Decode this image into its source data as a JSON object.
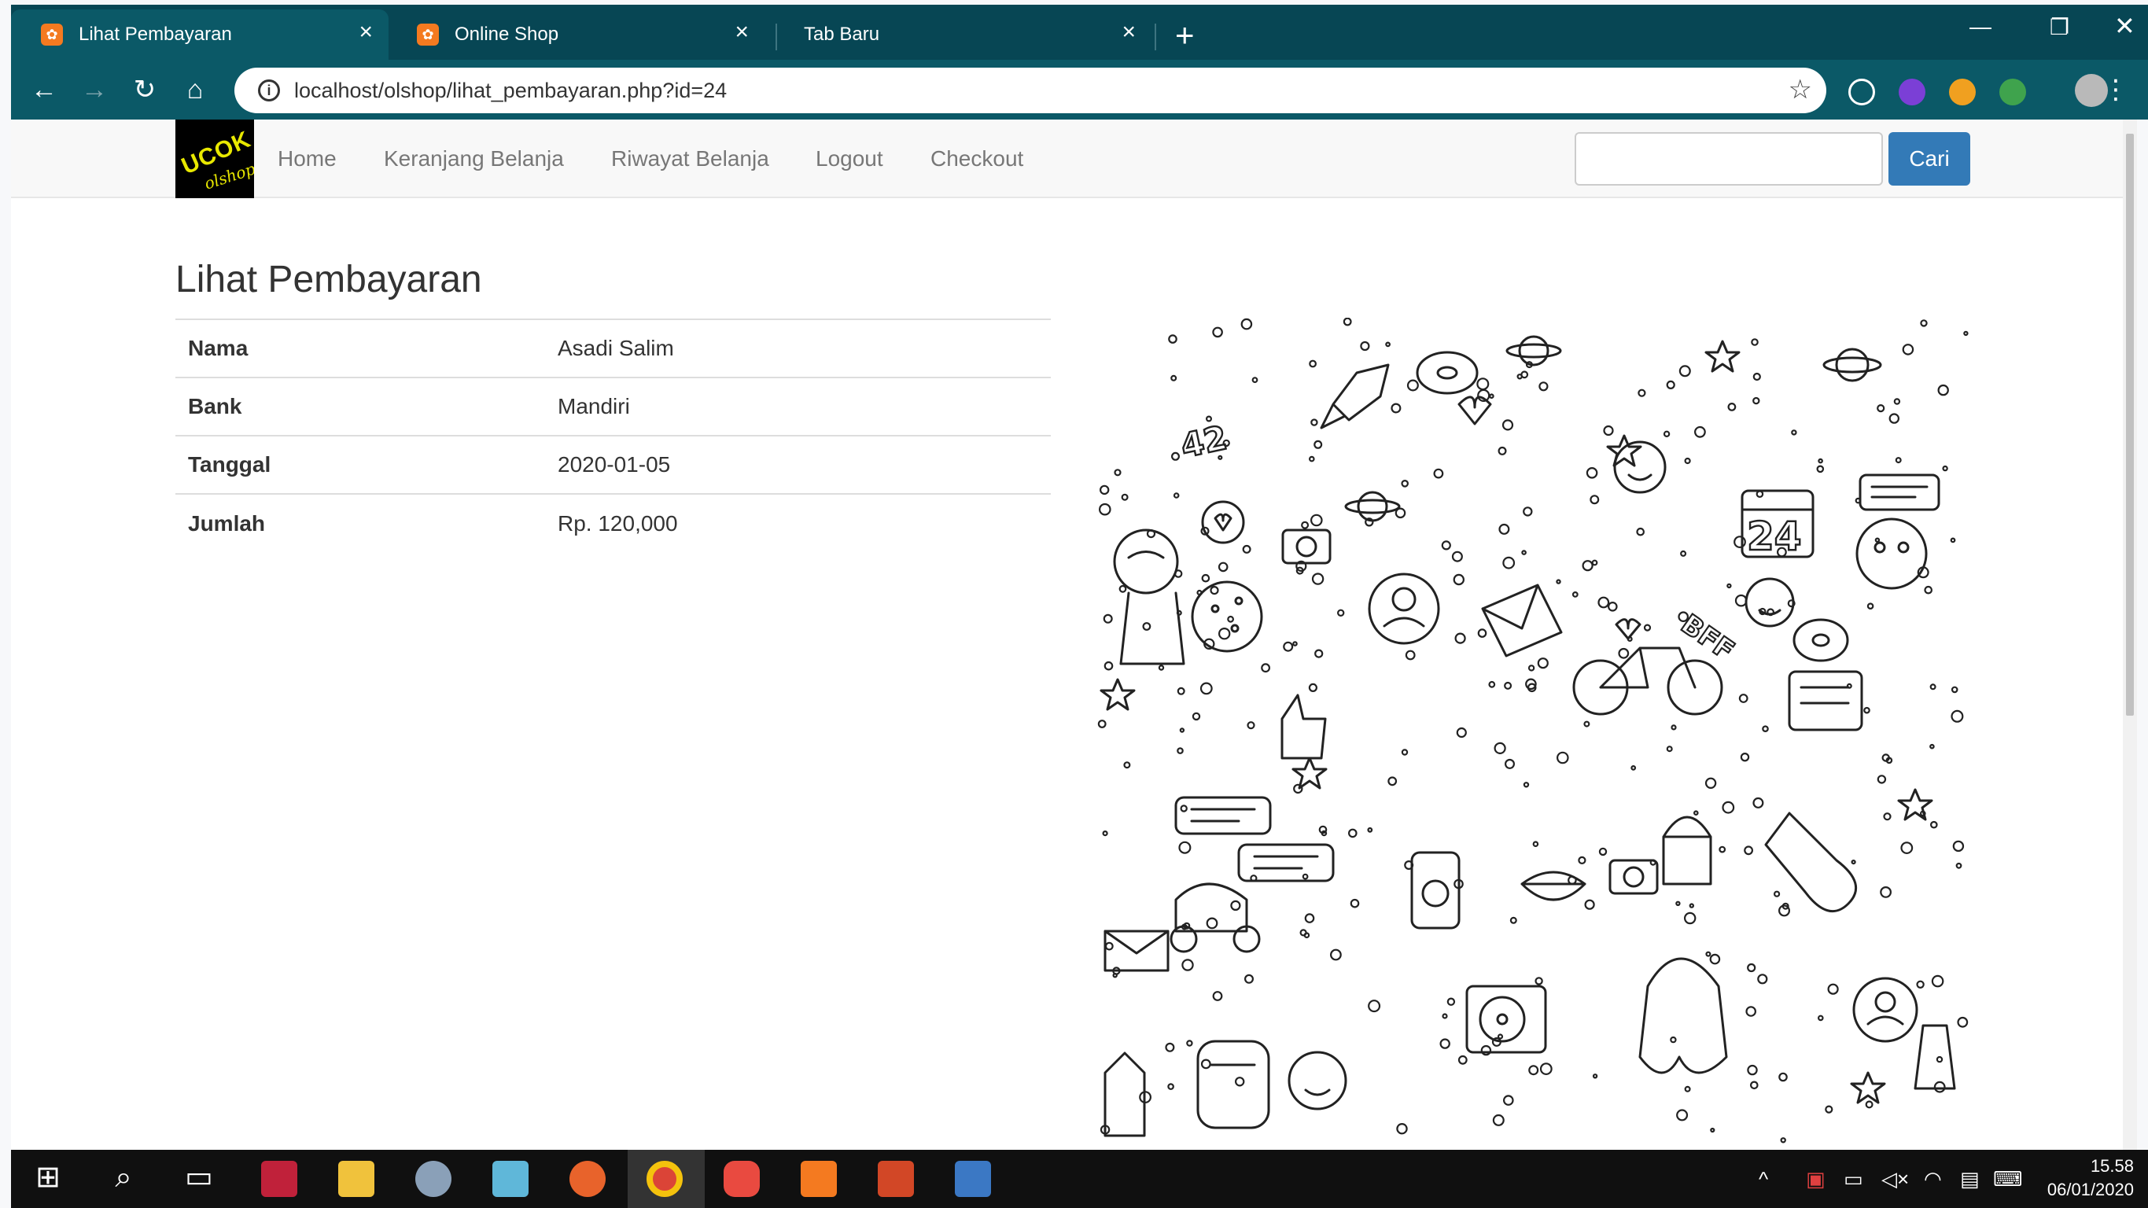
{
  "browser": {
    "tabs": [
      {
        "title": "Lihat Pembayaran",
        "active": true
      },
      {
        "title": "Online Shop",
        "active": false
      },
      {
        "title": "Tab Baru",
        "active": false
      }
    ],
    "url": "localhost/olshop/lihat_pembayaran.php?id=24",
    "new_tab_glyph": "+",
    "close_glyph": "×"
  },
  "navbar": {
    "logo_line1": "UCOK",
    "logo_line2": "olshop",
    "links": [
      "Home",
      "Keranjang Belanja",
      "Riwayat Belanja",
      "Logout",
      "Checkout"
    ],
    "search_placeholder": "",
    "search_button": "Cari"
  },
  "page": {
    "heading": "Lihat Pembayaran",
    "rows": [
      {
        "label": "Nama",
        "value": "Asadi Salim"
      },
      {
        "label": "Bank",
        "value": "Mandiri"
      },
      {
        "label": "Tanggal",
        "value": "2020-01-05"
      },
      {
        "label": "Jumlah",
        "value": "Rp. 120,000"
      }
    ],
    "image_text": {
      "number_a": "42",
      "number_b": "24",
      "bff": "BFF"
    }
  },
  "taskbar": {
    "time": "15.58",
    "date": "06/01/2020"
  },
  "colors": {
    "chrome_bg": "#074654",
    "toolbar_bg": "#0b5967",
    "primary_button": "#337ab7",
    "xampp_orange": "#f47a20"
  }
}
